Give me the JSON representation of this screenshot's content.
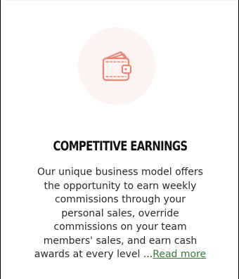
{
  "card": {
    "icon": "wallet-icon",
    "icon_color": "#ee8471",
    "icon_bg_color": "#fdf3f1",
    "title": "COMPETITIVE EARNINGS",
    "description_lines": [
      "Our unique business model offers",
      "the opportunity to earn weekly",
      "commissions through your",
      "personal sales, override",
      "commissions on your team",
      "members' sales, and earn cash",
      "awards at every level ..."
    ],
    "read_more_label": "Read more",
    "link_color": "#2e7d32"
  }
}
